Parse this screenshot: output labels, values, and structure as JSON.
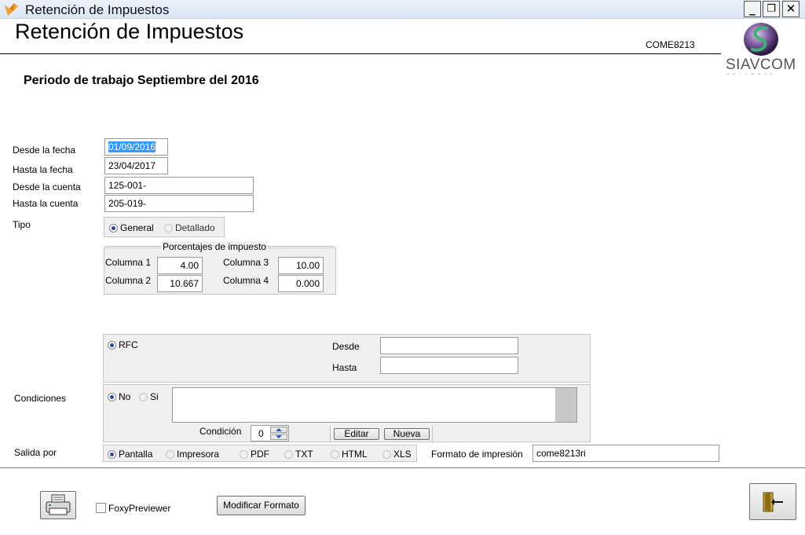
{
  "window": {
    "title": "Retención de Impuestos",
    "controls": {
      "minimize": "_",
      "restore": "❐",
      "close": "✕"
    }
  },
  "header": {
    "title": "Retención de Impuestos",
    "form_code": "COME8213",
    "logo_text": "SIAVCOM",
    "logo_sub": "software"
  },
  "period": "Periodo de trabajo Septiembre del 2016",
  "range": {
    "desde_fecha_label": "Desde la fecha",
    "desde_fecha": "01/09/2016",
    "hasta_fecha_label": "Hasta la fecha",
    "hasta_fecha": "23/04/2017",
    "desde_cuenta_label": "Desde la cuenta",
    "desde_cuenta": "125-001-",
    "hasta_cuenta_label": "Hasta la cuenta",
    "hasta_cuenta": "205-019-"
  },
  "tipo": {
    "label": "Tipo",
    "options": [
      "General",
      "Detallado"
    ],
    "selected": "General"
  },
  "porcentajes": {
    "legend": "Porcentajes de impuesto",
    "col1_label": "Columna 1",
    "col1": "4.00",
    "col2_label": "Columna 2",
    "col2": "10.667",
    "col3_label": "Columna 3",
    "col3": "10.00",
    "col4_label": "Columna 4",
    "col4": "0.000"
  },
  "rfc": {
    "option": "RFC",
    "desde_label": "Desde",
    "desde": "",
    "hasta_label": "Hasta",
    "hasta": ""
  },
  "condiciones": {
    "label": "Condiciones",
    "options": [
      "No",
      "Si"
    ],
    "selected": "No",
    "text": "",
    "condicion_label": "Condición",
    "condicion_value": "0",
    "editar": "Editar",
    "nueva": "Nueva"
  },
  "salida": {
    "label": "Salida por",
    "options": [
      "Pantalla",
      "Impresora",
      "PDF",
      "TXT",
      "HTML",
      "XLS"
    ],
    "selected": "Pantalla",
    "formato_label": "Formato de impresión",
    "formato_value": "come8213ri"
  },
  "footer": {
    "foxy_label": "FoxyPreviewer",
    "foxy_checked": false,
    "modificar": "Modificar Formato"
  },
  "icons": {
    "app": "fox-icon",
    "print": "printer-icon",
    "exit": "exit-door-icon"
  }
}
